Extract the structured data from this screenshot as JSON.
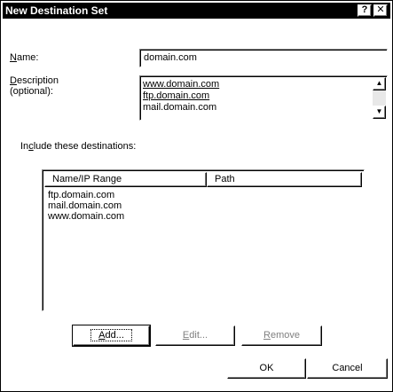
{
  "window": {
    "title": "New Destination Set",
    "help_glyph": "?",
    "close_glyph": "✕"
  },
  "form": {
    "name_label_u": "N",
    "name_label_rest": "ame:",
    "name_value": "domain.com",
    "description_label_u": "D",
    "description_label_rest": "escription",
    "description_label_2": "(optional):",
    "description_lines": [
      "www.domain.com",
      "ftp.domain.com",
      "mail.domain.com"
    ],
    "include_label_pre": "In",
    "include_label_u": "c",
    "include_label_rest": "lude these destinations:"
  },
  "list": {
    "columns": [
      "Name/IP Range",
      "Path"
    ],
    "rows": [
      "ftp.domain.com",
      "mail.domain.com",
      "www.domain.com"
    ]
  },
  "buttons": {
    "add_u": "A",
    "add_rest": "dd...",
    "edit_u": "E",
    "edit_rest": "dit...",
    "remove_u": "R",
    "remove_rest": "emove",
    "ok": "OK",
    "cancel": "Cancel"
  }
}
